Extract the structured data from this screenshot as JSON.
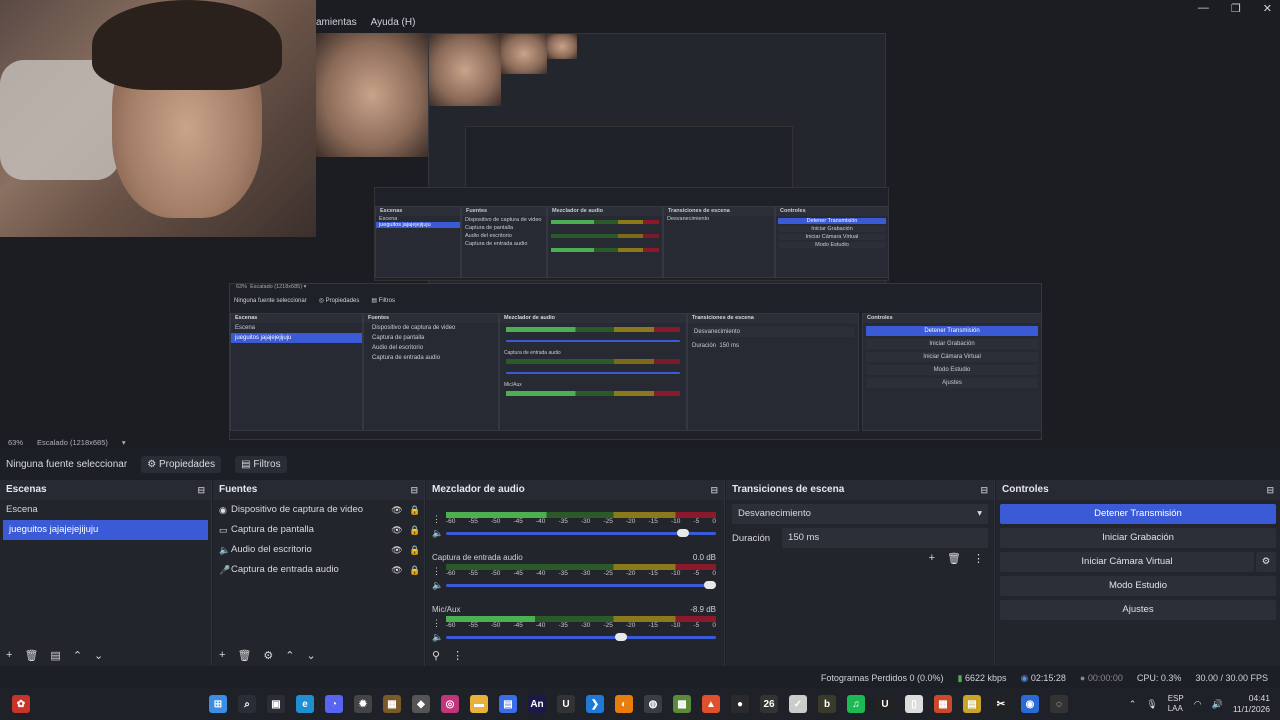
{
  "window": {
    "menu": [
      "amientas",
      "Ayuda (H)"
    ],
    "controls": [
      "—",
      "❐",
      "✕"
    ]
  },
  "preview_strip": {
    "zoom": "63%",
    "scale": "Escalado (1218x685)"
  },
  "source_toolbar": {
    "no_source": "Ninguna fuente seleccionar",
    "properties": "Propiedades",
    "filters": "Filtros"
  },
  "scenes": {
    "title": "Escenas",
    "items": [
      "Escena",
      "jueguitos jajajejejijuju"
    ],
    "selected_index": 1
  },
  "sources": {
    "title": "Fuentes",
    "items": [
      {
        "icon": "camera-icon",
        "glyph": "◉",
        "label": "Dispositivo de captura de video"
      },
      {
        "icon": "monitor-icon",
        "glyph": "▭",
        "label": "Captura de pantalla"
      },
      {
        "icon": "speaker-icon",
        "glyph": "🔈",
        "label": "Audio del escritorio"
      },
      {
        "icon": "microphone-icon",
        "glyph": "🎤",
        "label": "Captura de entrada audio"
      }
    ]
  },
  "mixer": {
    "title": "Mezclador de audio",
    "ticks": [
      "-60",
      "-55",
      "-50",
      "-45",
      "-40",
      "-35",
      "-30",
      "-25",
      "-20",
      "-15",
      "-10",
      "-5",
      "0"
    ],
    "channels": [
      {
        "name": "",
        "db": "",
        "level": 0.62,
        "volume": 0.9
      },
      {
        "name": "Captura de entrada audio",
        "db": "0.0 dB",
        "level": 0.0,
        "volume": 1.0
      },
      {
        "name": "Mic/Aux",
        "db": "-8.9 dB",
        "level": 0.55,
        "volume": 0.67
      }
    ]
  },
  "transitions": {
    "title": "Transiciones de escena",
    "selected": "Desvanecimiento",
    "duration_label": "Duración",
    "duration_value": "150 ms"
  },
  "controls": {
    "title": "Controles",
    "buttons": [
      "Detener Transmisión",
      "Iniciar Grabación",
      "Iniciar Cámara Virtual",
      "Modo Estudio",
      "Ajustes"
    ]
  },
  "status": {
    "dropped": "Fotogramas Perdidos 0 (0.0%)",
    "bitrate": "6622 kbps",
    "live_time": "02:15:28",
    "rec_time": "00:00:00",
    "cpu": "CPU: 0.3%",
    "fps": "30.00 / 30.00 FPS"
  },
  "taskbar": {
    "icons": [
      {
        "name": "windows-start-icon",
        "glyph": "⊞",
        "color": "#3a8ee6"
      },
      {
        "name": "search-icon",
        "glyph": "⌕",
        "color": "#2a2d35"
      },
      {
        "name": "task-view-icon",
        "glyph": "▣",
        "color": "#2a2d35"
      },
      {
        "name": "edge-icon",
        "glyph": "e",
        "color": "#1f8fd1"
      },
      {
        "name": "discord-icon",
        "glyph": "◔",
        "color": "#5865f2"
      },
      {
        "name": "settings-icon",
        "glyph": "✹",
        "color": "#444"
      },
      {
        "name": "minecraft-icon",
        "glyph": "▦",
        "color": "#7a5a2a"
      },
      {
        "name": "app-icon",
        "glyph": "◆",
        "color": "#555"
      },
      {
        "name": "instagram-icon",
        "glyph": "◎",
        "color": "#c1357a"
      },
      {
        "name": "folder-icon",
        "glyph": "▬",
        "color": "#e8b23a"
      },
      {
        "name": "store-icon",
        "glyph": "▤",
        "color": "#3a6ee8"
      },
      {
        "name": "animate-icon",
        "glyph": "An",
        "color": "#1a1a4a"
      },
      {
        "name": "ue-icon",
        "glyph": "U",
        "color": "#333"
      },
      {
        "name": "vscode-icon",
        "glyph": "❯",
        "color": "#1e7ad6"
      },
      {
        "name": "blender-icon",
        "glyph": "◐",
        "color": "#e87d0d"
      },
      {
        "name": "steam-icon",
        "glyph": "◍",
        "color": "#3a3d45"
      },
      {
        "name": "minecraft-launcher-icon",
        "glyph": "▩",
        "color": "#5a8a3a"
      },
      {
        "name": "brave-icon",
        "glyph": "▲",
        "color": "#e0502a"
      },
      {
        "name": "gpu-icon",
        "glyph": "●",
        "color": "#2a2a2a"
      },
      {
        "name": "app-26-icon",
        "glyph": "26",
        "color": "#333"
      },
      {
        "name": "check-icon",
        "glyph": "✓",
        "color": "#ccc"
      },
      {
        "name": "app-icon-2",
        "glyph": "b",
        "color": "#3a3a2a"
      },
      {
        "name": "spotify-icon",
        "glyph": "♫",
        "color": "#1db954"
      },
      {
        "name": "unreal-icon",
        "glyph": "U",
        "color": "#222"
      },
      {
        "name": "file-icon",
        "glyph": "▯",
        "color": "#ddd"
      },
      {
        "name": "app-icon-3",
        "glyph": "▦",
        "color": "#c94a2a"
      },
      {
        "name": "notes-icon",
        "glyph": "▤",
        "color": "#c9a42a"
      },
      {
        "name": "capcut-icon",
        "glyph": "✂",
        "color": "#222"
      },
      {
        "name": "app-icon-4",
        "glyph": "◉",
        "color": "#2a6ad6"
      },
      {
        "name": "obs-icon",
        "glyph": "◌",
        "color": "#333"
      }
    ],
    "lang": "ESP",
    "lang_sub": "LAA",
    "time": "04:41",
    "date": "11/1/2026"
  },
  "nested": {
    "dock_titles": [
      "Escenas",
      "Fuentes",
      "Mezclador de audio",
      "Transiciones de escena",
      "Controles"
    ],
    "no_source": "Ninguna fuente seleccionar",
    "properties": "Propiedades",
    "filters": "Filtros",
    "zoom": "63%",
    "scale": "Escalado (1218x685)"
  }
}
